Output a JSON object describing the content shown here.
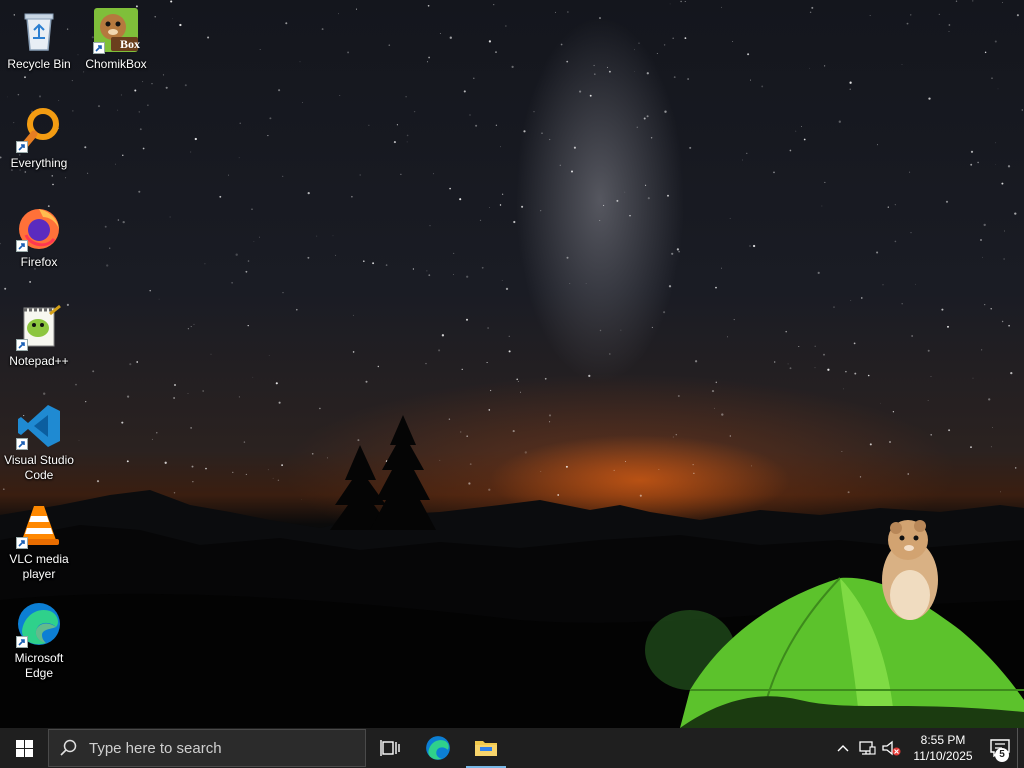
{
  "desktop": {
    "icons": [
      {
        "label": "Recycle Bin",
        "icon": "recycle-bin-icon"
      },
      {
        "label": "ChomikBox",
        "icon": "chomikbox-icon",
        "badge_text": "Box"
      },
      {
        "label": "Everything",
        "icon": "everything-search-icon"
      },
      {
        "label": "Firefox",
        "icon": "firefox-icon"
      },
      {
        "label": "Notepad++",
        "icon": "notepad-plus-plus-icon"
      },
      {
        "label": "Visual Studio Code",
        "icon": "vscode-icon"
      },
      {
        "label": "VLC media player",
        "icon": "vlc-icon"
      },
      {
        "label": "Microsoft Edge",
        "icon": "edge-icon"
      }
    ]
  },
  "taskbar": {
    "search_placeholder": "Type here to search",
    "clock_time": "8:55 PM",
    "clock_date": "11/10/2025",
    "notification_count": "5",
    "pinned": [
      "task-view-icon",
      "edge-icon",
      "file-explorer-icon"
    ]
  },
  "colors": {
    "taskbar": "#1f1f1f",
    "active_indicator": "#79b8e6",
    "tent_green": "#6fd23a"
  }
}
